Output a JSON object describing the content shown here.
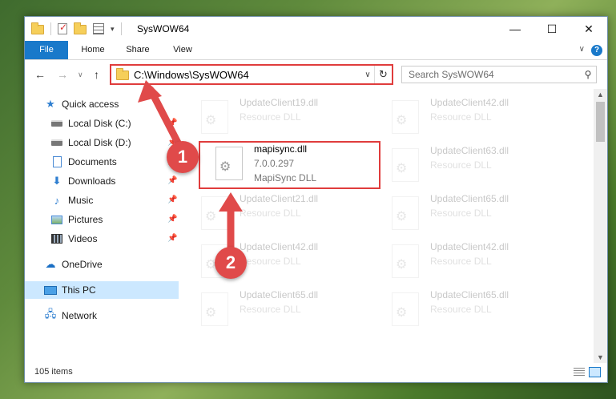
{
  "window": {
    "title": "SysWOW64",
    "minimize_glyph": "—",
    "maximize_glyph": "☐",
    "close_glyph": "✕"
  },
  "ribbon": {
    "tabs": [
      {
        "label": "File"
      },
      {
        "label": "Home"
      },
      {
        "label": "Share"
      },
      {
        "label": "View"
      }
    ],
    "help_glyph": "?",
    "collapse_glyph": "∨"
  },
  "nav": {
    "back_glyph": "←",
    "forward_glyph": "→",
    "recent_glyph": "∨",
    "up_glyph": "↑",
    "address": "C:\\Windows\\SysWOW64",
    "dropdown_glyph": "∨",
    "refresh_glyph": "↻",
    "search_placeholder": "Search SysWOW64",
    "search_glyph": "⚲"
  },
  "sidebar": {
    "items": [
      {
        "label": "Quick access",
        "icon": "star-icon",
        "pinned": false
      },
      {
        "label": "Local Disk (C:)",
        "icon": "drive-icon",
        "pinned": true
      },
      {
        "label": "Local Disk (D:)",
        "icon": "drive-icon",
        "pinned": true
      },
      {
        "label": "Documents",
        "icon": "documents-icon",
        "pinned": true
      },
      {
        "label": "Downloads",
        "icon": "downloads-icon",
        "pinned": true
      },
      {
        "label": "Music",
        "icon": "music-icon",
        "pinned": true
      },
      {
        "label": "Pictures",
        "icon": "pictures-icon",
        "pinned": true
      },
      {
        "label": "Videos",
        "icon": "videos-icon",
        "pinned": true
      },
      {
        "label": "OneDrive",
        "icon": "onedrive-icon",
        "pinned": false
      },
      {
        "label": "This PC",
        "icon": "this-pc-icon",
        "pinned": false,
        "selected": true
      },
      {
        "label": "Network",
        "icon": "network-icon",
        "pinned": false
      }
    ]
  },
  "files": {
    "highlighted": {
      "name": "mapisync.dll",
      "version": "7.0.0.297",
      "description": "MapiSync DLL"
    },
    "faded": [
      {
        "name": "UpdateClient19.dll",
        "type": "Resource DLL"
      },
      {
        "name": "UpdateClient42.dll",
        "type": "Resource DLL"
      },
      {
        "name": "UpdateClient63.dll",
        "type": "Resource DLL"
      },
      {
        "name": "UpdateClient21.dll",
        "type": "Resource DLL"
      },
      {
        "name": "UpdateClient65.dll",
        "type": "Resource DLL"
      },
      {
        "name": "UpdateClient42.dll",
        "type": "Resource DLL"
      },
      {
        "name": "UpdateClient42.dll",
        "type": "Resource DLL"
      },
      {
        "name": "UpdateClient65.dll",
        "type": "Resource DLL"
      },
      {
        "name": "UpdateClient65.dll",
        "type": "Resource DLL"
      }
    ]
  },
  "status": {
    "item_count": "105 items"
  },
  "callouts": {
    "one": "1",
    "two": "2"
  },
  "colors": {
    "accent": "#1979ca",
    "highlight": "#e03c3c",
    "selection": "#cce8ff"
  }
}
